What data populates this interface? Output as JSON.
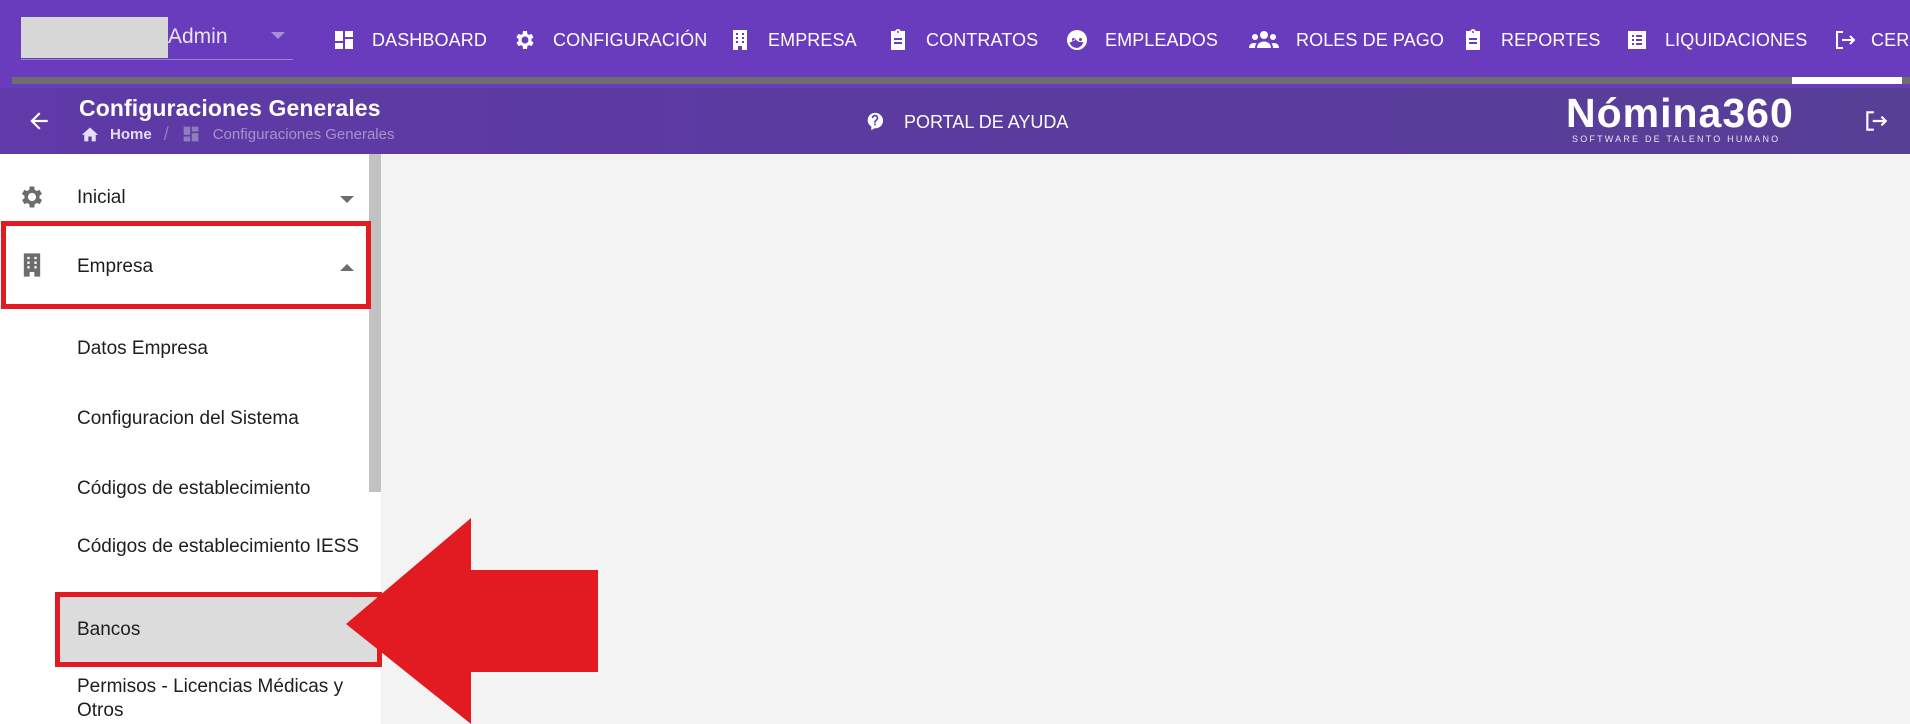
{
  "colors": {
    "brand_purple": "#683cbc",
    "subheader_purple": "#5a3b9e",
    "highlight_red": "#e21b23",
    "selected_bg": "#dcdcdc"
  },
  "user": {
    "name": "Admin"
  },
  "nav": {
    "items": [
      {
        "label": "DASHBOARD",
        "icon": "dashboard-icon"
      },
      {
        "label": "CONFIGURACIÓN",
        "icon": "gear-icon"
      },
      {
        "label": "EMPRESA",
        "icon": "building-icon"
      },
      {
        "label": "CONTRATOS",
        "icon": "clipboard-icon"
      },
      {
        "label": "EMPLEADOS",
        "icon": "face-icon"
      },
      {
        "label": "ROLES DE PAGO",
        "icon": "group-icon"
      },
      {
        "label": "REPORTES",
        "icon": "clipboard-icon"
      },
      {
        "label": "LIQUIDACIONES",
        "icon": "list-icon"
      },
      {
        "label": "CER",
        "icon": "logout-icon"
      }
    ]
  },
  "header": {
    "title": "Configuraciones Generales",
    "breadcrumb": {
      "home": "Home",
      "separator": "/",
      "current": "Configuraciones Generales"
    },
    "help_label": "PORTAL DE AYUDA",
    "logo_main": "Nómina360",
    "logo_sub": "SOFTWARE DE TALENTO HUMANO"
  },
  "sidebar": {
    "items": [
      {
        "label": "Inicial",
        "icon": "gear-icon",
        "expanded": false
      },
      {
        "label": "Empresa",
        "icon": "building-icon",
        "expanded": true
      }
    ],
    "submenu": [
      {
        "label": "Datos Empresa"
      },
      {
        "label": "Configuracion del Sistema"
      },
      {
        "label": "Códigos de establecimiento"
      },
      {
        "label": "Códigos de establecimiento IESS"
      },
      {
        "label": "Bancos",
        "selected": true
      },
      {
        "label": "Permisos - Licencias Médicas y Otros"
      }
    ]
  }
}
